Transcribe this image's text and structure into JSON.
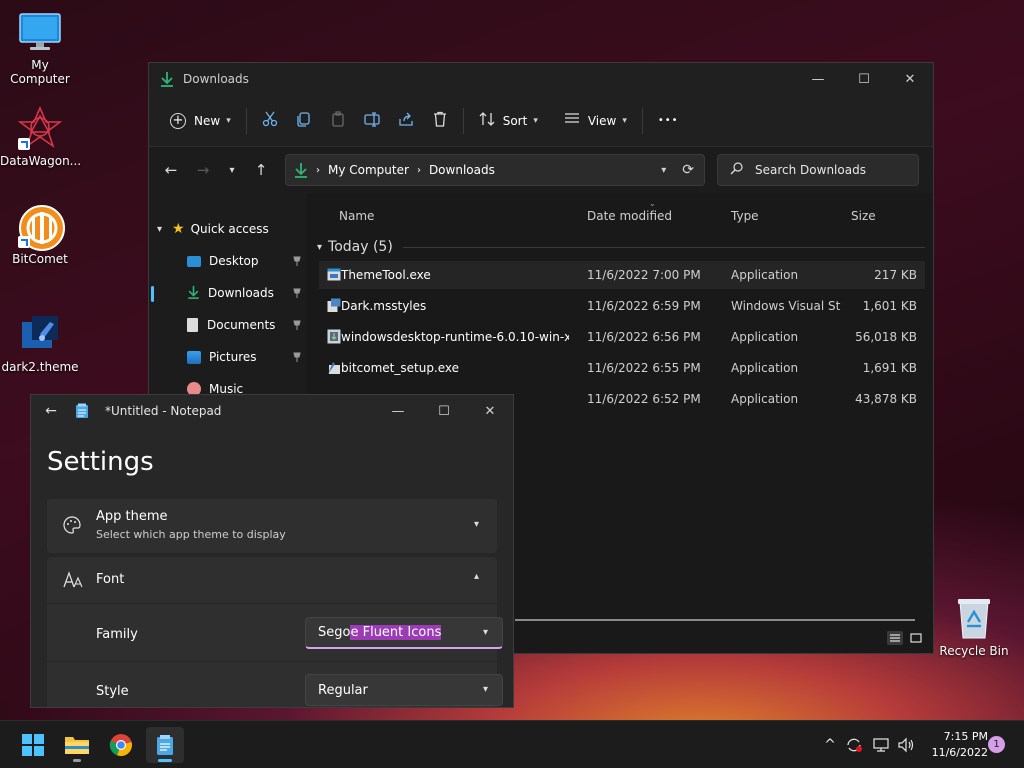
{
  "desktop": {
    "icons": [
      {
        "label": "My Computer"
      },
      {
        "label": "DataWagon..."
      },
      {
        "label": "BitComet"
      },
      {
        "label": "dark2.theme"
      },
      {
        "label": "Recycle Bin"
      }
    ]
  },
  "explorer": {
    "title": "Downloads",
    "toolbar": {
      "new_label": "New",
      "sort_label": "Sort",
      "view_label": "View",
      "more_label": "•••"
    },
    "address": {
      "segments": [
        "My Computer",
        "Downloads"
      ]
    },
    "search": {
      "placeholder": "Search Downloads"
    },
    "sidebar": {
      "quick_access": "Quick access",
      "items": [
        {
          "label": "Desktop"
        },
        {
          "label": "Downloads"
        },
        {
          "label": "Documents"
        },
        {
          "label": "Pictures"
        },
        {
          "label": "Music"
        }
      ]
    },
    "columns": {
      "name": "Name",
      "date": "Date modified",
      "type": "Type",
      "size": "Size"
    },
    "group": "Today (5)",
    "files": [
      {
        "name": "ThemeTool.exe",
        "date": "11/6/2022 7:00 PM",
        "type": "Application",
        "size": "217 KB"
      },
      {
        "name": "Dark.msstyles",
        "date": "11/6/2022 6:59 PM",
        "type": "Windows Visual St...",
        "size": "1,601 KB"
      },
      {
        "name": "windowsdesktop-runtime-6.0.10-win-x6...",
        "date": "11/6/2022 6:56 PM",
        "type": "Application",
        "size": "56,018 KB"
      },
      {
        "name": "bitcomet_setup.exe",
        "date": "11/6/2022 6:55 PM",
        "type": "Application",
        "size": "1,691 KB"
      },
      {
        "name": "",
        "date": "11/6/2022 6:52 PM",
        "type": "Application",
        "size": "43,878 KB"
      }
    ]
  },
  "notepad": {
    "title": "*Untitled - Notepad",
    "heading": "Settings",
    "app_theme": {
      "title": "App theme",
      "subtitle": "Select which app theme to display"
    },
    "font": {
      "title": "Font"
    },
    "family": {
      "label": "Family",
      "value_plain": "Sego",
      "value_selected": "e Fluent Icons"
    },
    "style": {
      "label": "Style",
      "value": "Regular"
    }
  },
  "taskbar": {
    "time": "7:15 PM",
    "date": "11/6/2022",
    "notification_count": "1"
  },
  "colors": {
    "accent": "#4cc2ff",
    "folder_green": "#2fb575",
    "selection_highlight": "#9b3bb5"
  }
}
